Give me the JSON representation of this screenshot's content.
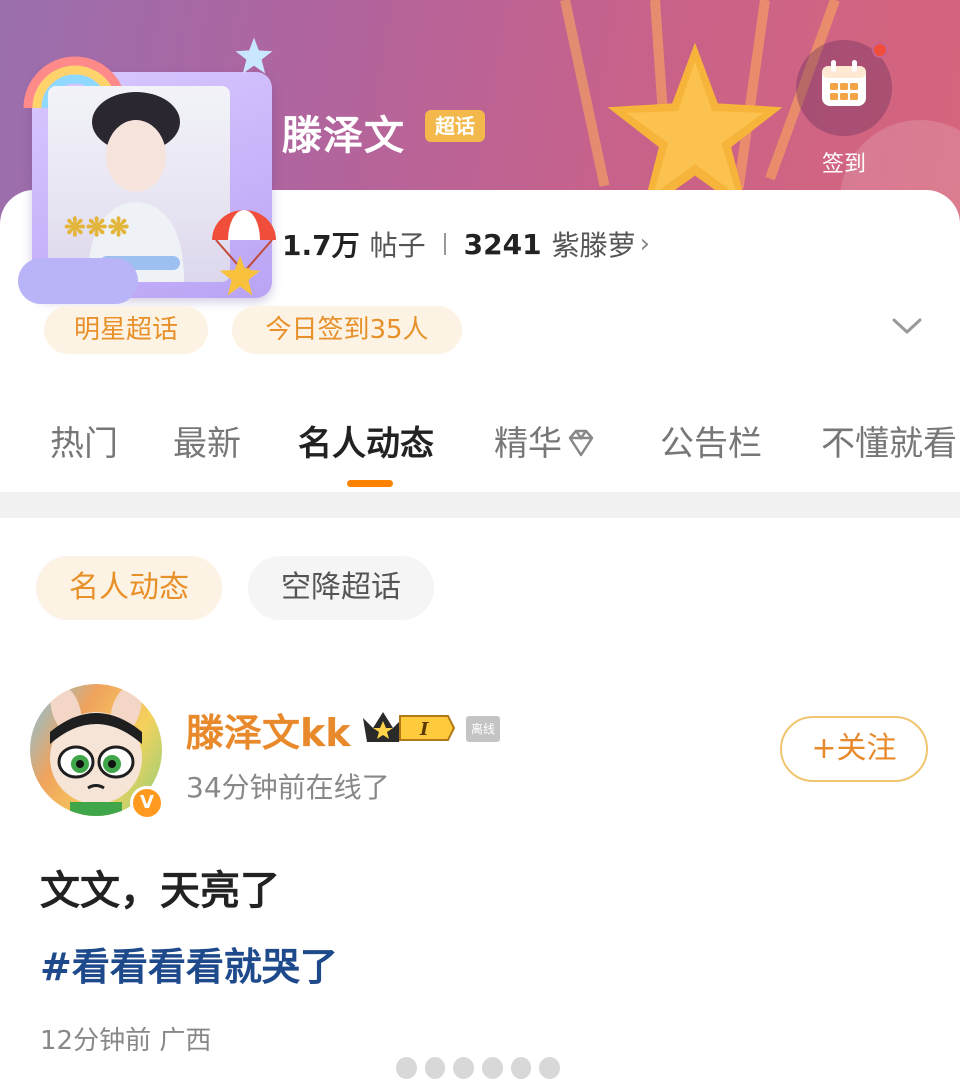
{
  "header": {
    "title": "滕泽文",
    "badge": "超话",
    "checkin_label": "签到",
    "stats": {
      "posts_count": "1.7万",
      "posts_label": "帖子",
      "members_count": "3241",
      "members_label": "紫滕萝"
    },
    "pills": [
      "明星超话",
      "今日签到35人"
    ]
  },
  "tabs": [
    "热门",
    "最新",
    "名人动态",
    "精华",
    "公告栏",
    "不懂就看"
  ],
  "active_tab": "名人动态",
  "sub_filters": [
    "名人动态",
    "空降超话"
  ],
  "post": {
    "author": "滕泽文kk",
    "level": "I",
    "status_tag": "离线",
    "online_status": "34分钟前在线了",
    "follow_label": "+关注",
    "verified_badge": "V",
    "content": "文文，天亮了",
    "hashtag": "#看看看看就哭了",
    "meta": "12分钟前 广西"
  },
  "colors": {
    "accent": "#ff8200",
    "pill_bg": "#fdf3e4",
    "pill_text": "#e8912b",
    "hashtag": "#1e4a8c"
  },
  "icons": [
    "calendar-icon",
    "chevron-right-icon",
    "chevron-down-icon",
    "gem-icon",
    "crown-icon",
    "verified-icon"
  ]
}
